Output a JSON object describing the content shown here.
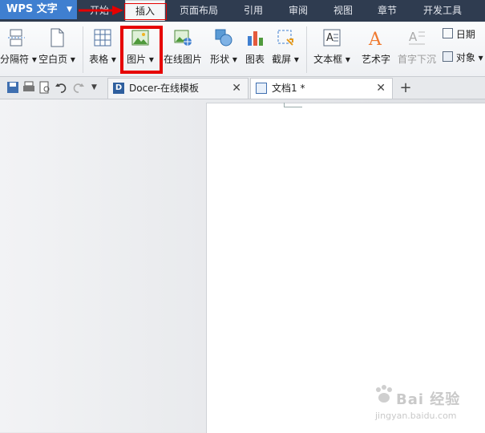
{
  "app": {
    "name": "WPS 文字"
  },
  "menu": {
    "tabs": [
      {
        "label": "开始"
      },
      {
        "label": "插入"
      },
      {
        "label": "页面布局"
      },
      {
        "label": "引用"
      },
      {
        "label": "审阅"
      },
      {
        "label": "视图"
      },
      {
        "label": "章节"
      },
      {
        "label": "开发工具"
      }
    ],
    "active": "插入"
  },
  "ribbon": {
    "page_break": "分隔符",
    "blank_page": "空白页",
    "table": "表格",
    "picture": "图片",
    "online_picture": "在线图片",
    "shape": "形状",
    "chart": "图表",
    "screenshot": "截屏",
    "textbox": "文本框",
    "wordart": "艺术字",
    "dropcap": "首字下沉",
    "date": "日期",
    "object": "对象"
  },
  "tabs": {
    "docer": "Docer-在线模板",
    "doc1": "文档1 *"
  },
  "watermark": {
    "brand": "Bai 经验",
    "url": "jingyan.baidu.com"
  },
  "colors": {
    "menubar": "#2f3c50",
    "accent": "#3f7fd0",
    "annotation": "#e60000"
  }
}
